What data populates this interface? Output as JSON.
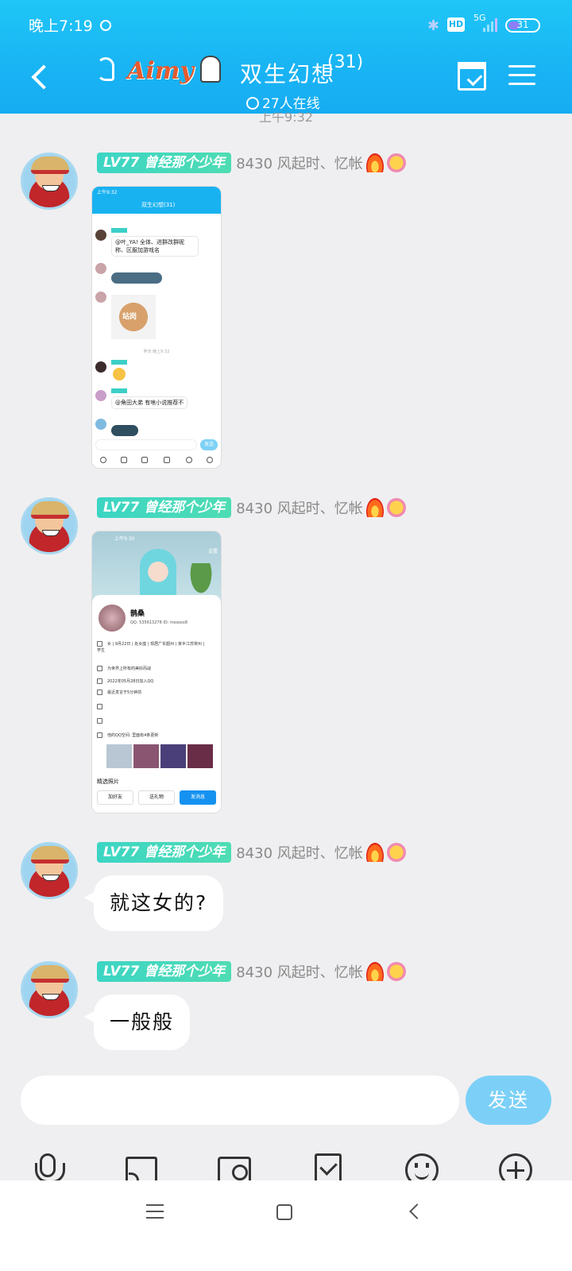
{
  "status_bar": {
    "time": "晚上7:19",
    "network": "5G",
    "hd": "HD",
    "battery": "31"
  },
  "header": {
    "group_name": "双生幻想",
    "member_count": "(31)",
    "online": "27人在线"
  },
  "timestamp_partial": "上午9:32",
  "sender": {
    "level": "LV77",
    "title": "曾经那个少年",
    "nickname": "8430 风起时、忆帐"
  },
  "messages": [
    {
      "type": "image"
    },
    {
      "type": "image"
    },
    {
      "type": "text",
      "text": "就这女的?"
    },
    {
      "type": "text",
      "text": "一般般"
    }
  ],
  "screenshot1": {
    "time": "上午9:32",
    "group": "双生幻想(31)",
    "msg1": "@叶_YA! 全体、进群改群昵称、区服加游戏名",
    "sticker_text": "站岗",
    "timestamp": "昨天 晚上9:32",
    "msg2": "@角田大弟 有啥小说推荐不",
    "send": "发送"
  },
  "screenshot2": {
    "time": "上午9:30",
    "settings": "设置",
    "name": "鹊桑",
    "qq": "QQ: 535613278  ID: mssoxx8",
    "row1": "女 | 9月22日 | 处女座 | 现居广东韶州 | 家乡江苏常州 | 学生",
    "row2": "为世界上所有的美好而战",
    "row3": "2022年05月28日加入QQ",
    "row4": "最近发言于5分钟前",
    "row5": "他的QQ空间: 里面有4条更新",
    "featured": "精选照片",
    "btn_add": "加好友",
    "btn_gift": "送礼物",
    "btn_msg": "发消息"
  },
  "composer": {
    "send": "发送"
  }
}
